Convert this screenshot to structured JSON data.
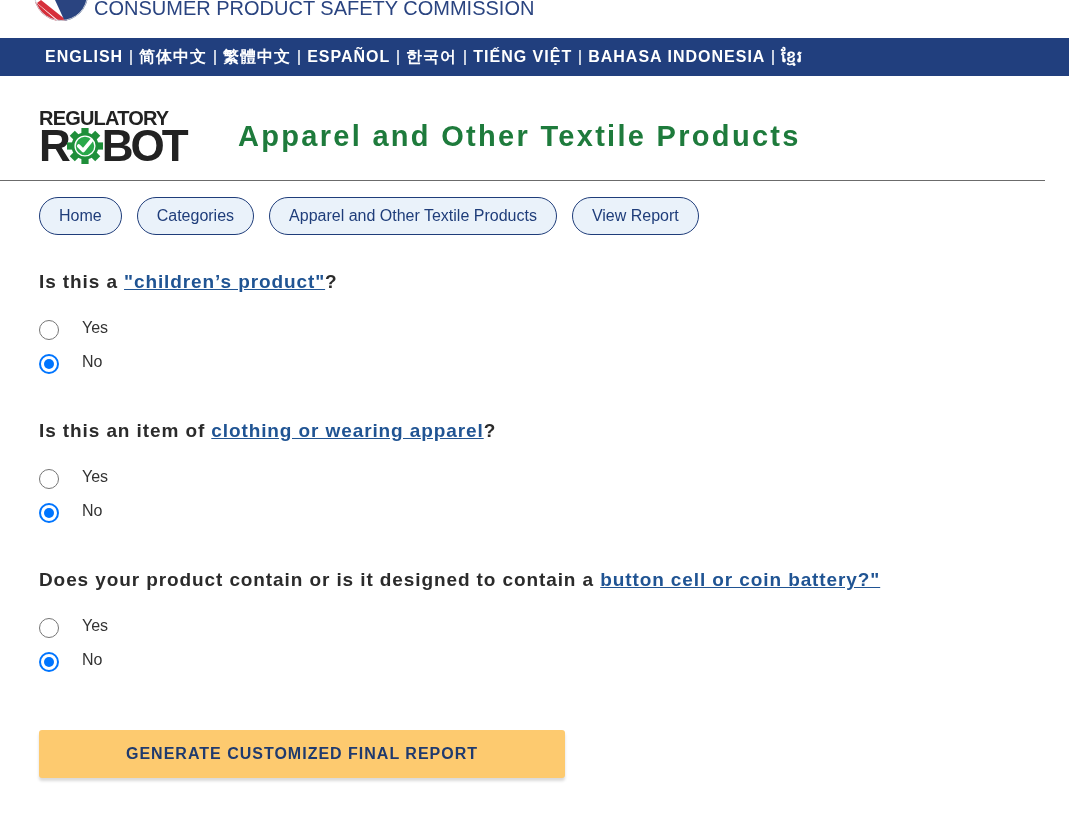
{
  "agency": {
    "name": "CONSUMER PRODUCT SAFETY COMMISSION"
  },
  "languages": [
    "ENGLISH",
    "简体中文",
    "繁體中文",
    "ESPAÑOL",
    "한국어",
    "TIẾNG VIỆT",
    "BAHASA INDONESIA",
    "ខ្មែរ"
  ],
  "logo": {
    "top": "REGULATORY",
    "left": "R",
    "right": "BOT"
  },
  "page_title": "Apparel and Other Textile Products",
  "breadcrumbs": [
    "Home",
    "Categories",
    "Apparel and Other Textile Products",
    "View Report"
  ],
  "questions": [
    {
      "text": "Is this a ",
      "link": "\"children’s product\"",
      "after": "?",
      "options": [
        {
          "label": "Yes",
          "selected": false
        },
        {
          "label": "No",
          "selected": true
        }
      ]
    },
    {
      "text": "Is this an item of ",
      "link": "clothing or wearing apparel",
      "after": "?",
      "options": [
        {
          "label": "Yes",
          "selected": false
        },
        {
          "label": "No",
          "selected": true
        }
      ]
    },
    {
      "text": "Does your product contain or is it designed to contain a ",
      "link": "button cell or coin battery?\"",
      "options": [
        {
          "label": "Yes",
          "selected": false
        },
        {
          "label": "No",
          "selected": true
        }
      ]
    }
  ],
  "submit_button": "GENERATE CUSTOMIZED FINAL REPORT"
}
